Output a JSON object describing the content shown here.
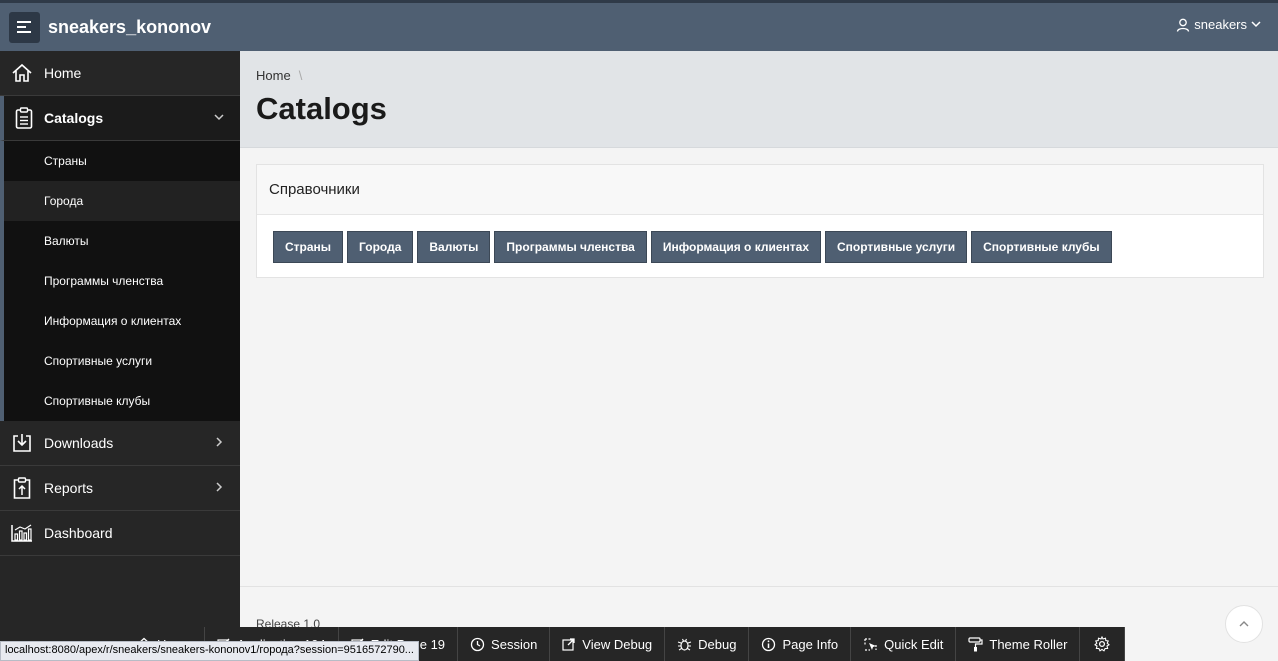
{
  "header": {
    "app_title": "sneakers_kononov",
    "user_label": "sneakers"
  },
  "sidebar": {
    "items": [
      {
        "label": "Home",
        "icon": "home-icon"
      },
      {
        "label": "Catalogs",
        "icon": "clipboard-icon",
        "expanded": true,
        "children": [
          "Страны",
          "Города",
          "Валюты",
          "Программы членства",
          "Информация о клиентах",
          "Спортивные услуги",
          "Спортивные клубы"
        ],
        "selected_child": "Города"
      },
      {
        "label": "Downloads",
        "icon": "download-icon"
      },
      {
        "label": "Reports",
        "icon": "clipboard-upload-icon"
      },
      {
        "label": "Dashboard",
        "icon": "bar-chart-icon"
      }
    ]
  },
  "breadcrumb": {
    "home": "Home",
    "separator": "\\"
  },
  "page": {
    "title": "Catalogs"
  },
  "region": {
    "title": "Справочники",
    "buttons": [
      "Страны",
      "Города",
      "Валюты",
      "Программы членства",
      "Информация о клиентах",
      "Спортивные услуги",
      "Спортивные клубы"
    ]
  },
  "footer": {
    "release": "Release 1.0"
  },
  "dev_toolbar": {
    "items": [
      "Home",
      "Application 104",
      "Edit Page 19",
      "Session",
      "View Debug",
      "Debug",
      "Page Info",
      "Quick Edit",
      "Theme Roller"
    ]
  },
  "status_url": "localhost:8080/apex/r/sneakers/sneakers-kononov1/города?session=9516572790...",
  "colors": {
    "header_bg": "#4f5f72",
    "sidebar_bg": "#262626",
    "button_bg": "#4f5f72",
    "title_bar_bg": "#e1e4e7"
  }
}
